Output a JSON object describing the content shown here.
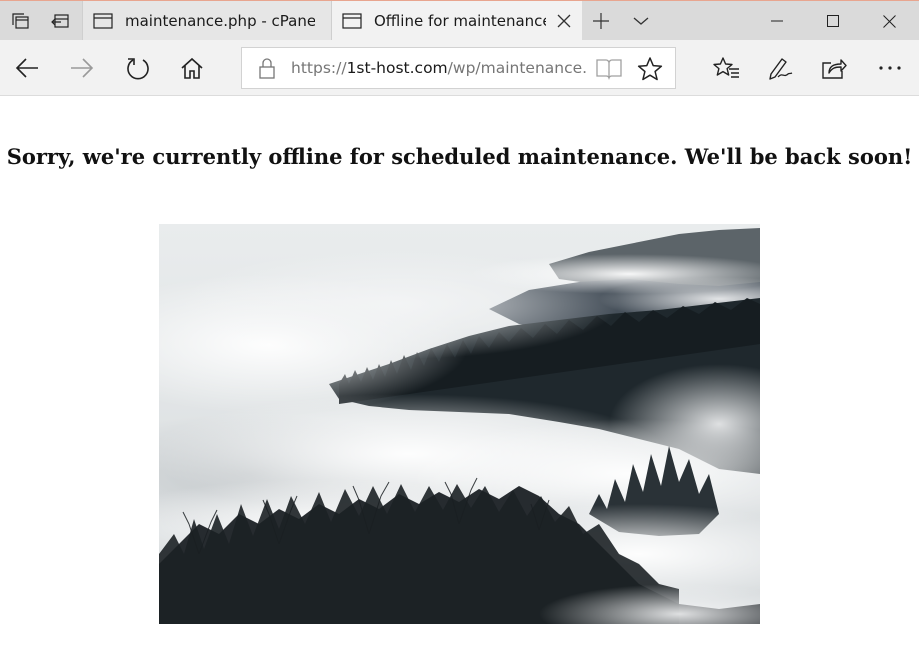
{
  "browser": {
    "tabs": [
      {
        "title": "maintenance.php - cPanel F",
        "active": false
      },
      {
        "title": "Offline for maintenance",
        "active": true
      }
    ],
    "address": {
      "scheme": "https://",
      "host": "1st-host.com",
      "path": "/wp/maintenance.ph"
    },
    "accent_color": "#e8a58f"
  },
  "page": {
    "headline": "Sorry, we're currently offline for scheduled maintenance. We'll be back soon!",
    "image": "misty-forest-photo"
  }
}
